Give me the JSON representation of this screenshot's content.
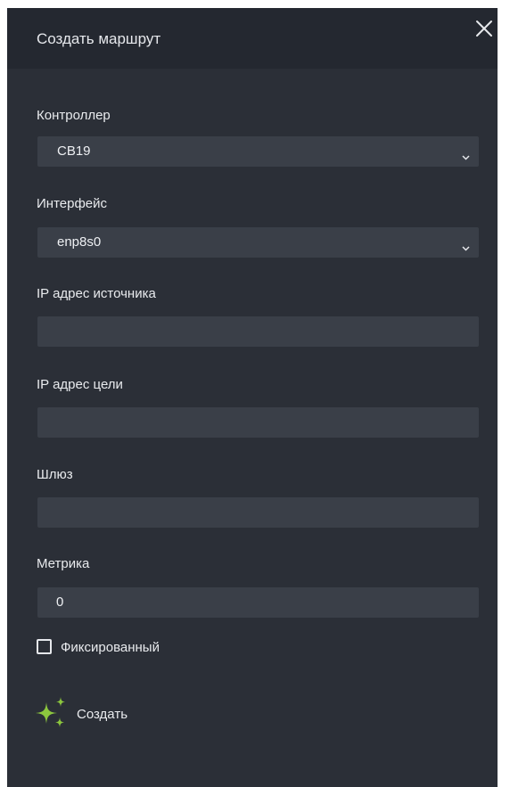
{
  "dialog": {
    "title": "Создать маршрут",
    "close_icon": "close-icon"
  },
  "fields": {
    "controller": {
      "label": "Контроллер",
      "value": "CB19"
    },
    "interface": {
      "label": "Интерфейс",
      "value": "enp8s0"
    },
    "source_ip": {
      "label": "IP адрес источника",
      "value": ""
    },
    "target_ip": {
      "label": "IP адрес цели",
      "value": ""
    },
    "gateway": {
      "label": "Шлюз",
      "value": ""
    },
    "metric": {
      "label": "Метрика",
      "value": "0"
    }
  },
  "fixed": {
    "label": "Фиксированный",
    "checked": false
  },
  "create": {
    "label": "Создать",
    "icon": "sparkles-icon"
  },
  "colors": {
    "panel_bg": "#2b2f37",
    "header_bg": "#242830",
    "field_bg": "#3a3f48",
    "text": "#e9ebee",
    "accent_green": "#8cc63e"
  }
}
